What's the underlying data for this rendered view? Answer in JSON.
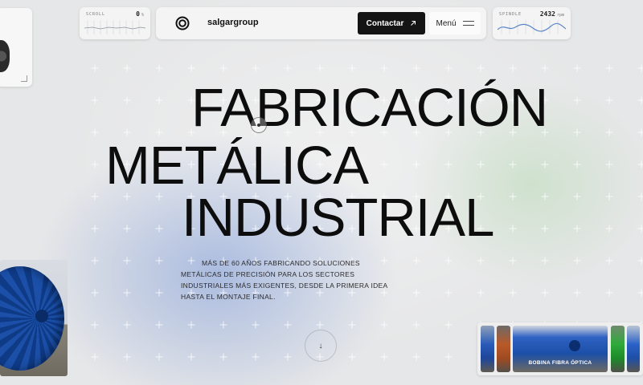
{
  "brand": {
    "name": "salgargroup"
  },
  "widgets": {
    "scroll": {
      "label": "SCROLL",
      "value": "0",
      "unit": "%"
    },
    "spindle": {
      "label": "SPINDLE",
      "value": "2432",
      "unit": "rpm"
    }
  },
  "nav": {
    "contact_label": "Contactar",
    "contact_icon": "arrow-up-right-icon",
    "menu_label": "Menú",
    "menu_icon": "hamburger-icon"
  },
  "hero": {
    "line1": "FABRICACIÓN",
    "line2": "METÁLICA",
    "line3": "INDUSTRIAL",
    "subtitle": "MÁS DE 60 AÑOS FABRICANDO SOLUCIONES METÁLICAS DE PRECISIÓN PARA LOS SECTORES INDUSTRIALES MÁS EXIGENTES, DESDE LA PRIMERA IDEA HASTA EL MONTAJE FINAL."
  },
  "scroll_down": {
    "icon": "arrow-down-icon",
    "glyph": "↓"
  },
  "carousel": {
    "active_label": "BOBINA FIBRA ÓPTICA"
  },
  "colors": {
    "background": "#e6e7e8",
    "dark_button": "#141414",
    "blue_glow": "#7896d7",
    "green_glow": "#afd7aa",
    "reel_blue": "#1b4fa8"
  }
}
